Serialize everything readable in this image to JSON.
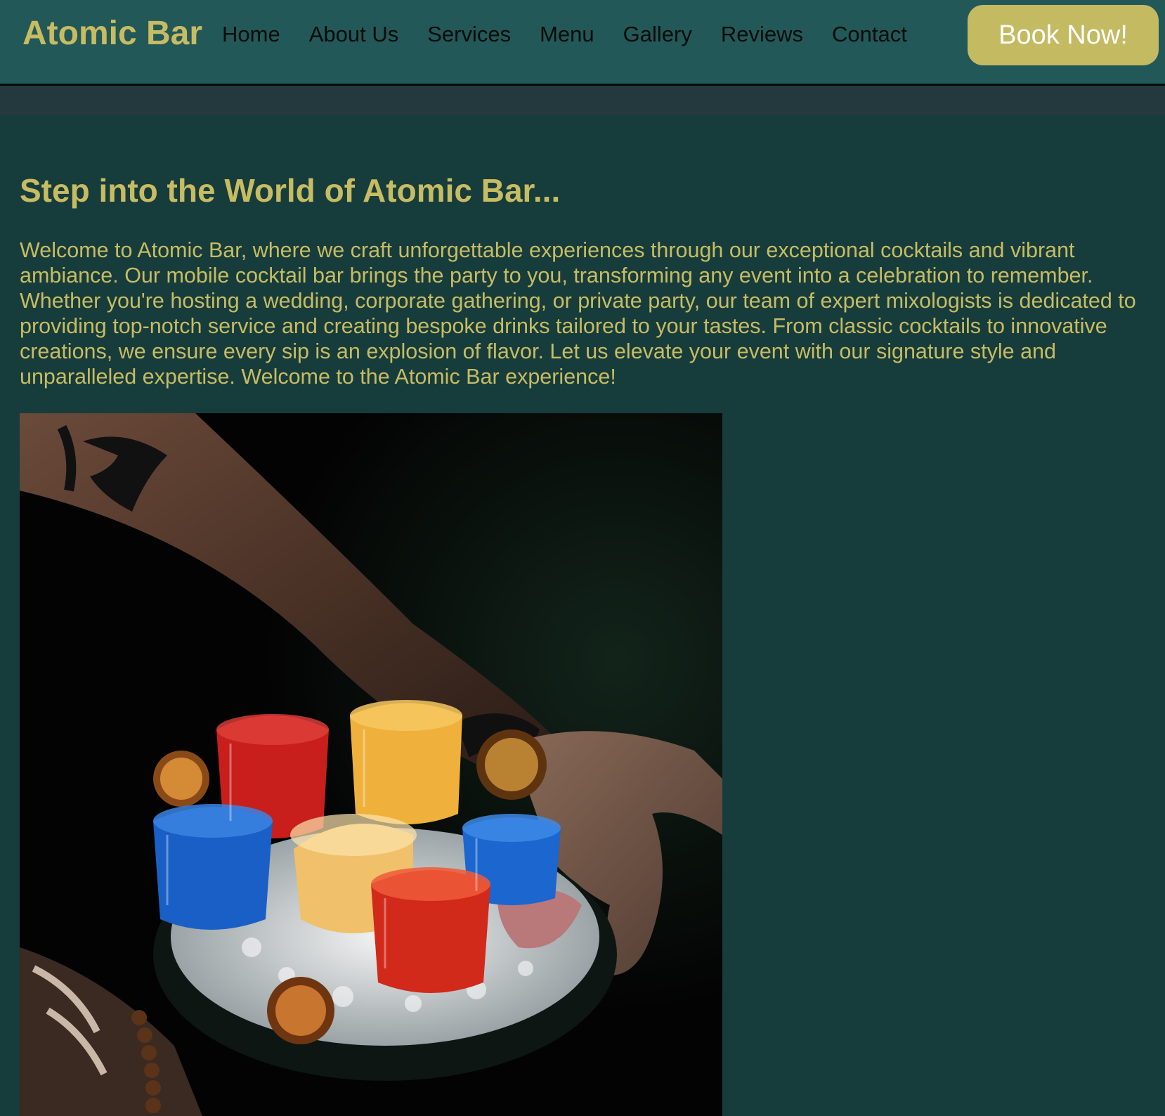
{
  "header": {
    "logo": "Atomic Bar",
    "nav": [
      "Home",
      "About Us",
      "Services",
      "Menu",
      "Gallery",
      "Reviews",
      "Contact"
    ],
    "cta_label": "Book Now!"
  },
  "main": {
    "heading": "Step into the World of Atomic Bar...",
    "intro": "Welcome to Atomic Bar, where we craft unforgettable experiences through our exceptional cocktails and vibrant ambiance. Our mobile cocktail bar brings the party to you, transforming any event into a celebration to remember. Whether you're hosting a wedding, corporate gathering, or private party, our team of expert mixologists is dedicated to providing top-notch service and creating bespoke drinks tailored to your tastes. From classic cocktails to innovative creations, we ensure every sip is an explosion of flavor. Let us elevate your event with our signature style and unparalleled expertise. Welcome to the Atomic Bar experience!"
  },
  "colors": {
    "background": "#173c3c",
    "navbar": "#225858",
    "accent_gold": "#c7bc62",
    "button": "#c4ba62",
    "nav_text": "#0b0b0b"
  }
}
